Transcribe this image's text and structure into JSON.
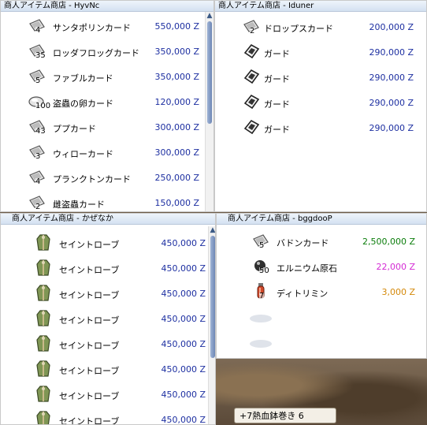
{
  "colors": {
    "price_blue": "#1d2fa1",
    "price_green": "#0b7d0b",
    "price_magenta": "#d42ad4",
    "price_orange": "#d4890a"
  },
  "shops": [
    {
      "title": "商人アイテム商店 - HyvNc",
      "items": [
        {
          "icon": "card-icon",
          "qty": "4",
          "name": "サンタポリンカード",
          "price": "550,000 Z"
        },
        {
          "icon": "card-icon",
          "qty": "35",
          "name": "ロッダフロッグカード",
          "price": "350,000 Z"
        },
        {
          "icon": "card-icon",
          "qty": "5",
          "name": "ファブルカード",
          "price": "350,000 Z"
        },
        {
          "icon": "egg-icon",
          "qty": "100",
          "name": "盗蟲の卵カード",
          "price": "120,000 Z"
        },
        {
          "icon": "card-icon",
          "qty": "43",
          "name": "ププカード",
          "price": "300,000 Z"
        },
        {
          "icon": "card-icon",
          "qty": "3",
          "name": "ウィローカード",
          "price": "300,000 Z"
        },
        {
          "icon": "card-icon",
          "qty": "4",
          "name": "プランクトンカード",
          "price": "250,000 Z"
        },
        {
          "icon": "card-icon",
          "qty": "2",
          "name": "雌盗蟲カード",
          "price": "150,000 Z"
        }
      ]
    },
    {
      "title": "商人アイテム商店 - Iduner",
      "items": [
        {
          "icon": "card-icon",
          "qty": "2",
          "name": "ドロップスカード",
          "price": "200,000 Z"
        },
        {
          "icon": "guard-icon",
          "qty": "",
          "name": "ガード",
          "price": "290,000 Z"
        },
        {
          "icon": "guard-icon",
          "qty": "",
          "name": "ガード",
          "price": "290,000 Z"
        },
        {
          "icon": "guard-icon",
          "qty": "",
          "name": "ガード",
          "price": "290,000 Z"
        },
        {
          "icon": "guard-icon",
          "qty": "",
          "name": "ガード",
          "price": "290,000 Z"
        }
      ]
    },
    {
      "title": "商人アイテム商店 - かぜなか",
      "items": [
        {
          "icon": "robe-icon",
          "qty": "",
          "name": "セイントローブ",
          "price": "450,000 Z"
        },
        {
          "icon": "robe-icon",
          "qty": "",
          "name": "セイントローブ",
          "price": "450,000 Z"
        },
        {
          "icon": "robe-icon",
          "qty": "",
          "name": "セイントローブ",
          "price": "450,000 Z"
        },
        {
          "icon": "robe-icon",
          "qty": "",
          "name": "セイントローブ",
          "price": "450,000 Z"
        },
        {
          "icon": "robe-icon",
          "qty": "",
          "name": "セイントローブ",
          "price": "450,000 Z"
        },
        {
          "icon": "robe-icon",
          "qty": "",
          "name": "セイントローブ",
          "price": "450,000 Z"
        },
        {
          "icon": "robe-icon",
          "qty": "",
          "name": "セイントローブ",
          "price": "450,000 Z"
        },
        {
          "icon": "robe-icon",
          "qty": "",
          "name": "セイントローブ",
          "price": "450,000 Z"
        }
      ]
    },
    {
      "title": "商人アイテム商店 - bggdooP",
      "items": [
        {
          "icon": "card-icon",
          "qty": "5",
          "name": "バドンカード",
          "price": "2,500,000 Z",
          "color": "#0b7d0b"
        },
        {
          "icon": "ore-icon",
          "qty": "50",
          "name": "エルニウム原石",
          "price": "22,000 Z",
          "color": "#d42ad4"
        },
        {
          "icon": "potion-icon",
          "qty": "7",
          "name": "ディトリミン",
          "price": "3,000 Z",
          "color": "#d4890a"
        }
      ]
    }
  ],
  "chat": {
    "text": "+7熱血鉢巻き 6"
  }
}
